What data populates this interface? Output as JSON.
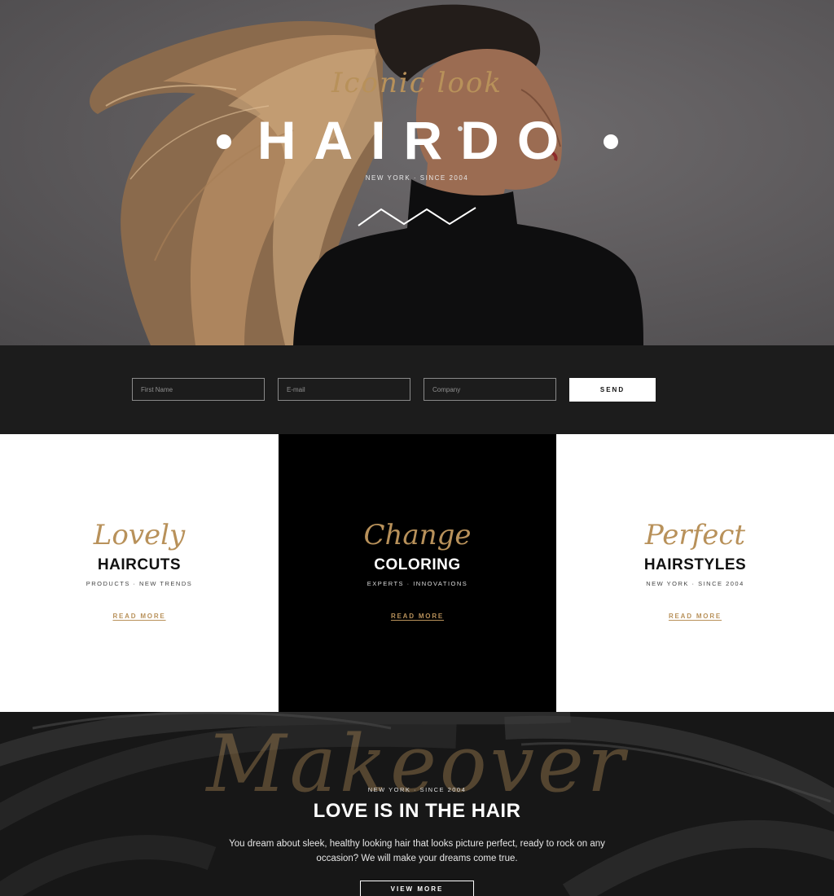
{
  "hero": {
    "script_title": "Iconic look",
    "brand": "HAIRDO",
    "tagline": "NEW YORK · SINCE 2004"
  },
  "form": {
    "first_name_placeholder": "First Name",
    "email_placeholder": "E-mail",
    "company_placeholder": "Company",
    "send_label": "SEND"
  },
  "cards": [
    {
      "script": "Lovely",
      "heading": "HAIRCUTS",
      "sub": "PRODUCTS · NEW TRENDS",
      "link": "READ MORE"
    },
    {
      "script": "Change",
      "heading": "COLORING",
      "sub": "EXPERTS · INNOVATIONS",
      "link": "READ MORE"
    },
    {
      "script": "Perfect",
      "heading": "HAIRSTYLES",
      "sub": "NEW YORK · SINCE 2004",
      "link": "READ MORE"
    }
  ],
  "love": {
    "script": "Makeover",
    "small": "NEW YORK · SINCE 2004",
    "heading": "LOVE IS IN THE HAIR",
    "paragraph": "You dream about sleek, healthy looking hair that looks picture perfect, ready to rock on any occasion? We will make your dreams come true.",
    "button": "VIEW MORE"
  },
  "colors": {
    "accent": "#b8915a",
    "dark": "#000000",
    "form_bg": "#1c1c1c"
  }
}
